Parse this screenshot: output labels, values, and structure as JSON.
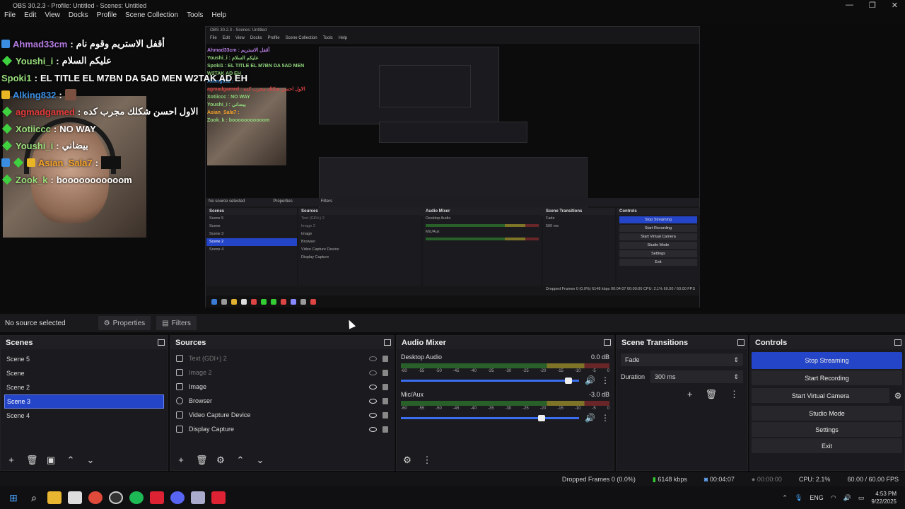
{
  "window": {
    "title": "OBS 30.2.3 - Profile: Untitled - Scenes: Untitled",
    "controls": [
      "—",
      "❐",
      "✕"
    ]
  },
  "menu": [
    "File",
    "Edit",
    "View",
    "Docks",
    "Profile",
    "Scene Collection",
    "Tools",
    "Help"
  ],
  "chat": [
    {
      "user": "Ahmad33cm",
      "msg": "أقفل الاستريم وقوم نام",
      "color": "#b47be0",
      "icons": [
        "badge-blue"
      ]
    },
    {
      "user": "Youshi_i",
      "msg": "عليكم السلام",
      "color": "#9ae07c",
      "icons": [
        "diamond"
      ]
    },
    {
      "user": "Spoki1",
      "msg": "EL TITLE EL M7BN DA 5AD MEN W2TAK AD EH",
      "color": "#9ae07c",
      "icons": []
    },
    {
      "user": "Alking832",
      "msg": "",
      "color": "#3a8de0",
      "icons": [
        "badge-gold"
      ],
      "emote": true
    },
    {
      "user": "agmadgamed",
      "msg": "الاول احسن شكلك مجرب كده",
      "color": "#e23b3b",
      "icons": [
        "diamond"
      ]
    },
    {
      "user": "Xotiiccc",
      "msg": "NO WAY",
      "color": "#9ae07c",
      "icons": [
        "diamond"
      ]
    },
    {
      "user": "Youshi_i",
      "msg": "بيضاني",
      "color": "#9ae07c",
      "icons": [
        "diamond"
      ]
    },
    {
      "user": "Asian_Sala7",
      "msg": "",
      "color": "#f4a32a",
      "icons": [
        "badge-blue",
        "diamond",
        "badge-gold"
      ],
      "block": true
    },
    {
      "user": "Zook_k",
      "msg": "booooooooooom",
      "color": "#9ae07c",
      "icons": [
        "diamond"
      ]
    }
  ],
  "nested": {
    "title": "OBS 30.2.3 - Scenes: Untitled",
    "menu": [
      "File",
      "Edit",
      "View",
      "Docks",
      "Profile",
      "Scene Collection",
      "Tools",
      "Help"
    ],
    "chat": [
      "Ahmad33cm : أقفل الاستريم",
      "Youshi_i : عليكم السلام",
      "Spoki1 : EL TITLE EL M7BN DA 5AD MEN W2TAK AD EH",
      "Alking832 :",
      "agmadgamed : الاول احسن شكلك مجرب كده",
      "Xotiiccc : NO WAY",
      "Youshi_i : بيضاني",
      "Asian_Sala7 :",
      "Zook_k : booooooooooom"
    ],
    "ctx": "No source selected",
    "props": "Properties",
    "filters": "Filters",
    "scenes": [
      "Scene 5",
      "Scene",
      "Scene 3",
      "Scene 2",
      "Scene 4"
    ],
    "sources": [
      "Text (GDI+) 2",
      "Image 2",
      "Image",
      "Browser",
      "Video Capture Device",
      "Display Capture"
    ],
    "controls": [
      "Stop Streaming",
      "Start Recording",
      "Start Virtual Camera",
      "Studio Mode",
      "Settings",
      "Exit"
    ],
    "mixer": [
      "Desktop Audio",
      "Mic/Aux"
    ],
    "transition": "Fade",
    "duration": "500 ms",
    "status": "Dropped Frames 0 (0.0%)   6148 kbps   00:04:07   00:00:00   CPU: 2.1%   60.00 / 60.00 FPS"
  },
  "context": {
    "selection": "No source selected",
    "properties": "Properties",
    "filters": "Filters"
  },
  "scenes": {
    "title": "Scenes",
    "items": [
      "Scene 5",
      "Scene",
      "Scene 2",
      "Scene 3",
      "Scene 4"
    ],
    "selected": 3
  },
  "sources": {
    "title": "Sources",
    "items": [
      {
        "name": "Text (GDI+) 2",
        "visible": false,
        "icon": "text-icon"
      },
      {
        "name": "Image 2",
        "visible": false,
        "icon": "image-icon"
      },
      {
        "name": "Image",
        "visible": true,
        "icon": "image-icon"
      },
      {
        "name": "Browser",
        "visible": true,
        "icon": "globe-icon"
      },
      {
        "name": "Video Capture Device",
        "visible": true,
        "icon": "camera-icon"
      },
      {
        "name": "Display Capture",
        "visible": true,
        "icon": "monitor-icon"
      }
    ]
  },
  "mixer": {
    "title": "Audio Mixer",
    "channels": [
      {
        "name": "Desktop Audio",
        "db": "0.0 dB",
        "level": 0.96
      },
      {
        "name": "Mic/Aux",
        "db": "-3.0 dB",
        "level": 0.81
      }
    ],
    "scale": [
      "-60",
      "-55",
      "-50",
      "-45",
      "-40",
      "-35",
      "-30",
      "-25",
      "-20",
      "-15",
      "-10",
      "-5",
      "0"
    ]
  },
  "transitions": {
    "title": "Scene Transitions",
    "type": "Fade",
    "duration_label": "Duration",
    "duration": "300 ms"
  },
  "controls": {
    "title": "Controls",
    "buttons": [
      "Stop Streaming",
      "Start Recording",
      "Start Virtual Camera",
      "Studio Mode",
      "Settings",
      "Exit"
    ]
  },
  "status": {
    "dropped": "Dropped Frames 0 (0.0%)",
    "kbps": "6148 kbps",
    "stream_time": "00:04:07",
    "rec_time": "00:00:00",
    "cpu": "CPU: 2.1%",
    "fps": "60.00 / 60.00 FPS"
  },
  "taskbar": {
    "lang": "ENG",
    "time": "4:53 PM",
    "date": "9/22/2025"
  },
  "colors": {
    "accent": "#2545c8",
    "bg": "#1b1b1f"
  }
}
